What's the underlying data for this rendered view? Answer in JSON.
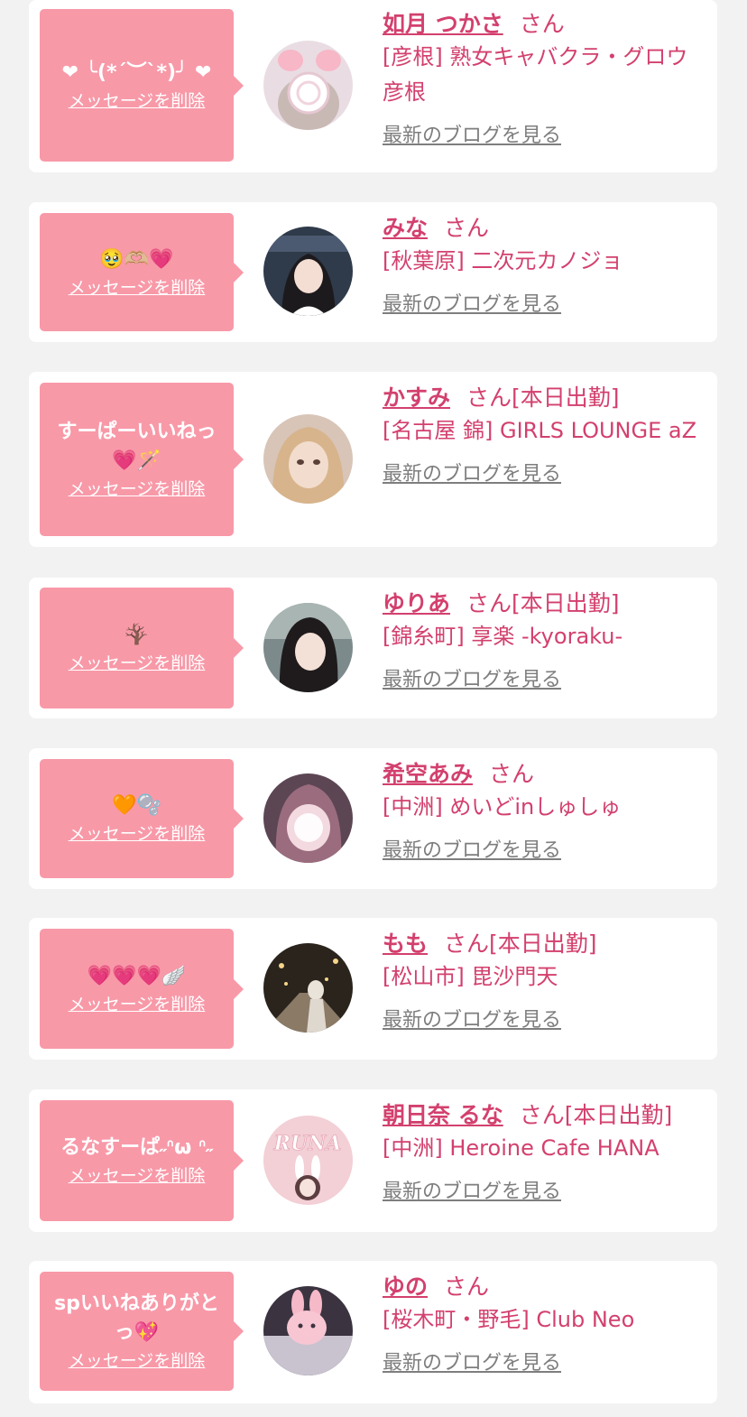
{
  "common": {
    "delete_label": "メッセージを削除",
    "blog_label": "最新のブログを見る",
    "san": "さん",
    "honorific_today": "[本日出勤]"
  },
  "colors": {
    "bubble_pink": "#f899a8",
    "name_pink": "#d3406e",
    "link_gray": "#7e7e7e",
    "page_bg": "#f2f2f2"
  },
  "messages": [
    {
      "message": "❤︎ ╰(*´︶`*)╯ ❤︎",
      "name": "如月 つかさ",
      "working_today": "",
      "shop": "[彦根] 熟女キャバクラ・グロウ彦根",
      "avatar_icon": "avatar-ears-icon"
    },
    {
      "message": "🥹🫶🏼💗",
      "name": "みな",
      "working_today": "",
      "shop": "[秋葉原] 二次元カノジョ",
      "avatar_icon": "avatar-girl-icon"
    },
    {
      "message": "すーぱーいいねっ💗🪄",
      "name": "かすみ",
      "working_today": "[本日出勤]",
      "shop": "[名古屋 錦] GIRLS LOUNGE aZ",
      "avatar_icon": "avatar-blonde-icon"
    },
    {
      "message": "🪾",
      "name": "ゆりあ",
      "working_today": "[本日出勤]",
      "shop": "[錦糸町] 享楽 -kyoraku-",
      "avatar_icon": "avatar-darkhair-icon"
    },
    {
      "message": "🧡🫧",
      "name": "希空あみ",
      "working_today": "",
      "shop": "[中洲] めいどinしゅしゅ",
      "avatar_icon": "avatar-blur-icon"
    },
    {
      "message": "💗💗💗🪽",
      "name": "もも",
      "working_today": "[本日出勤]",
      "shop": "[松山市] 毘沙門天",
      "avatar_icon": "avatar-night-icon"
    },
    {
      "message": "るなすーぱ˶ᐢω ᐢ˶",
      "name": "朝日奈 るな",
      "working_today": "[本日出勤]",
      "shop": "[中洲] Heroine Cafe HANA",
      "avatar_icon": "avatar-runa-icon",
      "avatar_text": "RUNA"
    },
    {
      "message": "spいいねありがとっ💖",
      "name": "ゆの",
      "working_today": "",
      "shop": "[桜木町・野毛] Club Neo",
      "avatar_icon": "avatar-bunny-icon"
    }
  ]
}
